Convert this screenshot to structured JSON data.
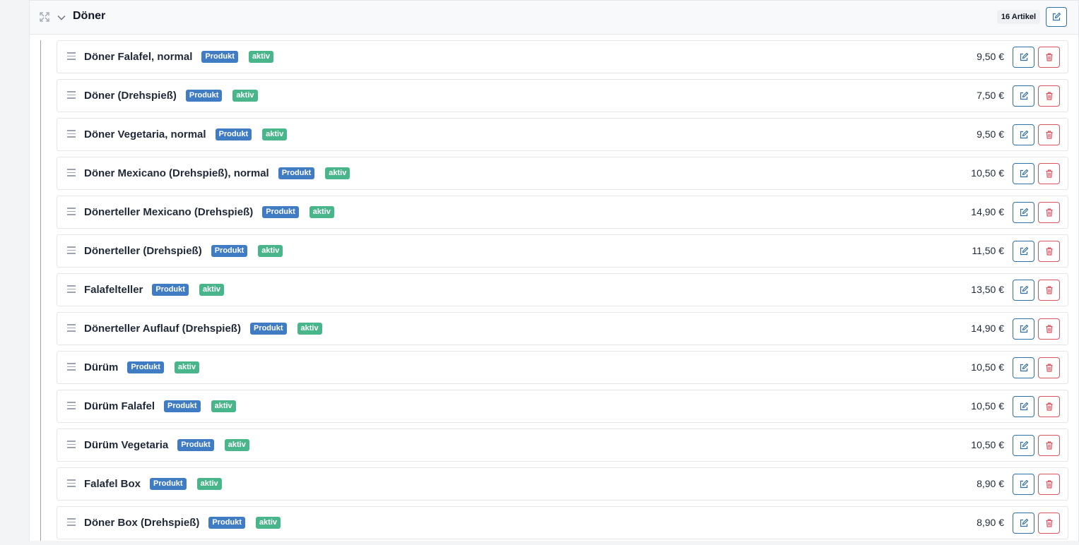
{
  "category": {
    "title": "Döner",
    "count_label": "16 Artikel"
  },
  "items": [
    {
      "name": "Döner Falafel, normal",
      "type": "Produkt",
      "status": "aktiv",
      "price": "9,50 €"
    },
    {
      "name": "Döner (Drehspieß)",
      "type": "Produkt",
      "status": "aktiv",
      "price": "7,50 €"
    },
    {
      "name": "Döner Vegetaria, normal",
      "type": "Produkt",
      "status": "aktiv",
      "price": "9,50 €"
    },
    {
      "name": "Döner Mexicano (Drehspieß), normal",
      "type": "Produkt",
      "status": "aktiv",
      "price": "10,50 €"
    },
    {
      "name": "Dönerteller Mexicano (Drehspieß)",
      "type": "Produkt",
      "status": "aktiv",
      "price": "14,90 €"
    },
    {
      "name": "Dönerteller (Drehspieß)",
      "type": "Produkt",
      "status": "aktiv",
      "price": "11,50 €"
    },
    {
      "name": "Falafelteller",
      "type": "Produkt",
      "status": "aktiv",
      "price": "13,50 €"
    },
    {
      "name": "Dönerteller Auflauf (Drehspieß)",
      "type": "Produkt",
      "status": "aktiv",
      "price": "14,90 €"
    },
    {
      "name": "Dürüm",
      "type": "Produkt",
      "status": "aktiv",
      "price": "10,50 €"
    },
    {
      "name": "Dürüm Falafel",
      "type": "Produkt",
      "status": "aktiv",
      "price": "10,50 €"
    },
    {
      "name": "Dürüm Vegetaria",
      "type": "Produkt",
      "status": "aktiv",
      "price": "10,50 €"
    },
    {
      "name": "Falafel Box",
      "type": "Produkt",
      "status": "aktiv",
      "price": "8,90 €"
    },
    {
      "name": "Döner Box (Drehspieß)",
      "type": "Produkt",
      "status": "aktiv",
      "price": "8,90 €"
    }
  ],
  "colors": {
    "produkt_badge": "#3f7cc4",
    "aktiv_badge": "#48b58a",
    "edit_button": "#2f6fa7",
    "delete_button": "#d9525e"
  },
  "icons": {
    "header_left": [
      "expand-icon",
      "chevron-down-icon"
    ],
    "row": [
      "drag-handle-icon",
      "edit-icon",
      "trash-icon"
    ]
  }
}
